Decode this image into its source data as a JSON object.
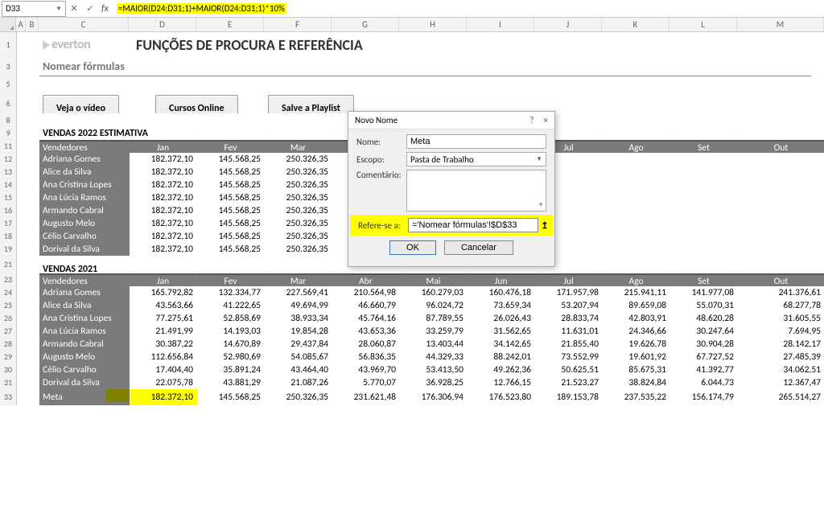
{
  "namebox": "D33",
  "formula": "=MAIOR(D24:D31;1)+MAIOR(D24:D31;1)*10%",
  "cols": [
    "A",
    "B",
    "C",
    "D",
    "E",
    "F",
    "G",
    "H",
    "I",
    "J",
    "K",
    "L",
    "M"
  ],
  "rows_top": [
    "1",
    "3",
    "5",
    "6",
    "8",
    "9",
    "11",
    "12",
    "13",
    "14",
    "15",
    "16",
    "17",
    "18",
    "19",
    "21",
    "23",
    "24",
    "25",
    "26",
    "27",
    "28",
    "29",
    "30",
    "31",
    "33"
  ],
  "brand": "everton",
  "page_title": "FUNÇÕES DE PROCURA E REFERÊNCIA",
  "section": "Nomear fórmulas",
  "buttons": {
    "video": "Veja o vídeo",
    "cursos": "Cursos Online",
    "playlist": "Salve a Playlist"
  },
  "est_title": "VENDAS 2022 ESTIMATIVA",
  "v2021_title": "VENDAS 2021",
  "months": [
    "Jan",
    "Fev",
    "Mar",
    "Abr",
    "Mai",
    "Jun",
    "Jul",
    "Ago",
    "Set",
    "Out"
  ],
  "vend_label": "Vendedores",
  "vendedores": [
    "Adriana Gomes",
    "Alice da Silva",
    "Ana Cristina Lopes",
    "Ana Lúcia Ramos",
    "Armando Cabral",
    "Augusto Melo",
    "Célio Carvalho",
    "Dorival da Silva"
  ],
  "est_vals": {
    "jan": "182.372,10",
    "fev": "145.568,25",
    "mar": "250.326,35"
  },
  "v2021": [
    [
      "165.792,82",
      "132.334,77",
      "227.569,41",
      "210.564,98",
      "160.279,03",
      "160.476,18",
      "171.957,98",
      "215.941,11",
      "141.977,08",
      "241.376,61"
    ],
    [
      "43.563,66",
      "41.222,65",
      "49.694,99",
      "46.660,79",
      "96.024,72",
      "73.659,34",
      "53.207,94",
      "89.659,08",
      "55.070,31",
      "68.277,78"
    ],
    [
      "77.275,61",
      "52.858,69",
      "38.933,34",
      "45.764,16",
      "87.789,55",
      "26.026,43",
      "28.833,74",
      "42.803,91",
      "48.620,28",
      "31.605,55"
    ],
    [
      "21.491,99",
      "14.193,03",
      "19.854,28",
      "43.653,36",
      "33.259,79",
      "31.562,65",
      "11.631,01",
      "24.346,66",
      "30.247,64",
      "7.694,95"
    ],
    [
      "30.387,22",
      "14.670,89",
      "29.437,84",
      "28.060,87",
      "13.403,44",
      "34.142,65",
      "21.855,40",
      "19.626,78",
      "30.904,28",
      "28.142,17"
    ],
    [
      "112.656,84",
      "52.980,69",
      "54.085,67",
      "56.836,35",
      "44.329,33",
      "88.242,01",
      "73.552,99",
      "19.601,92",
      "67.727,52",
      "27.485,39"
    ],
    [
      "17.404,40",
      "35.891,24",
      "43.464,40",
      "43.969,70",
      "53.413,50",
      "49.262,36",
      "50.625,51",
      "85.675,31",
      "41.392,77",
      "34.062,51"
    ],
    [
      "22.075,78",
      "43.881,29",
      "21.087,26",
      "5.770,07",
      "36.928,25",
      "12.766,15",
      "21.523,27",
      "38.824,84",
      "6.044,73",
      "12.367,47"
    ]
  ],
  "meta_label": "Meta",
  "meta_vals": [
    "182.372,10",
    "145.568,25",
    "250.326,35",
    "231.621,48",
    "176.306,94",
    "176.523,80",
    "189.153,78",
    "237.535,22",
    "156.174,79",
    "265.514,27"
  ],
  "dialog": {
    "title": "Novo Nome",
    "help": "?",
    "close": "×",
    "nome_lbl": "Nome:",
    "nome_val": "Meta",
    "escopo_lbl": "Escopo:",
    "escopo_val": "Pasta de Trabalho",
    "com_lbl": "Comentário:",
    "ref_lbl": "Refere-se a:",
    "ref_val": "='Nomear fórmulas'!$D$33",
    "ok": "OK",
    "cancel": "Cancelar"
  }
}
